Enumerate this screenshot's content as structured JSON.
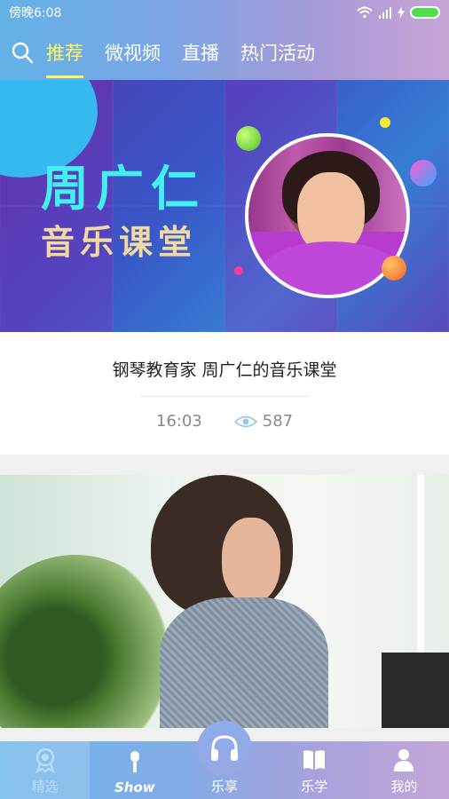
{
  "status": {
    "time": "傍晚6:08"
  },
  "nav": {
    "tabs": [
      {
        "label": "推荐",
        "active": true
      },
      {
        "label": "微视频"
      },
      {
        "label": "直播"
      },
      {
        "label": "热门活动"
      }
    ]
  },
  "banner": {
    "title": "周广仁",
    "subtitle": "音乐课堂"
  },
  "card": {
    "title": "钢琴教育家 周广仁的音乐课堂",
    "duration": "16:03",
    "views": "587"
  },
  "tabbar": {
    "items": [
      {
        "label": "精选",
        "icon": "medal-icon",
        "active": true
      },
      {
        "label": "Show",
        "icon": "microphone-icon"
      },
      {
        "label": "乐享",
        "icon": "headphones-icon"
      },
      {
        "label": "乐学",
        "icon": "book-icon"
      },
      {
        "label": "我的",
        "icon": "user-icon"
      }
    ]
  },
  "colors": {
    "accent": "#fff95c",
    "header_start": "#63b2e8",
    "header_end": "#c9a4d6",
    "banner_title": "#42f0f0",
    "banner_sub": "#f3d9a0"
  }
}
